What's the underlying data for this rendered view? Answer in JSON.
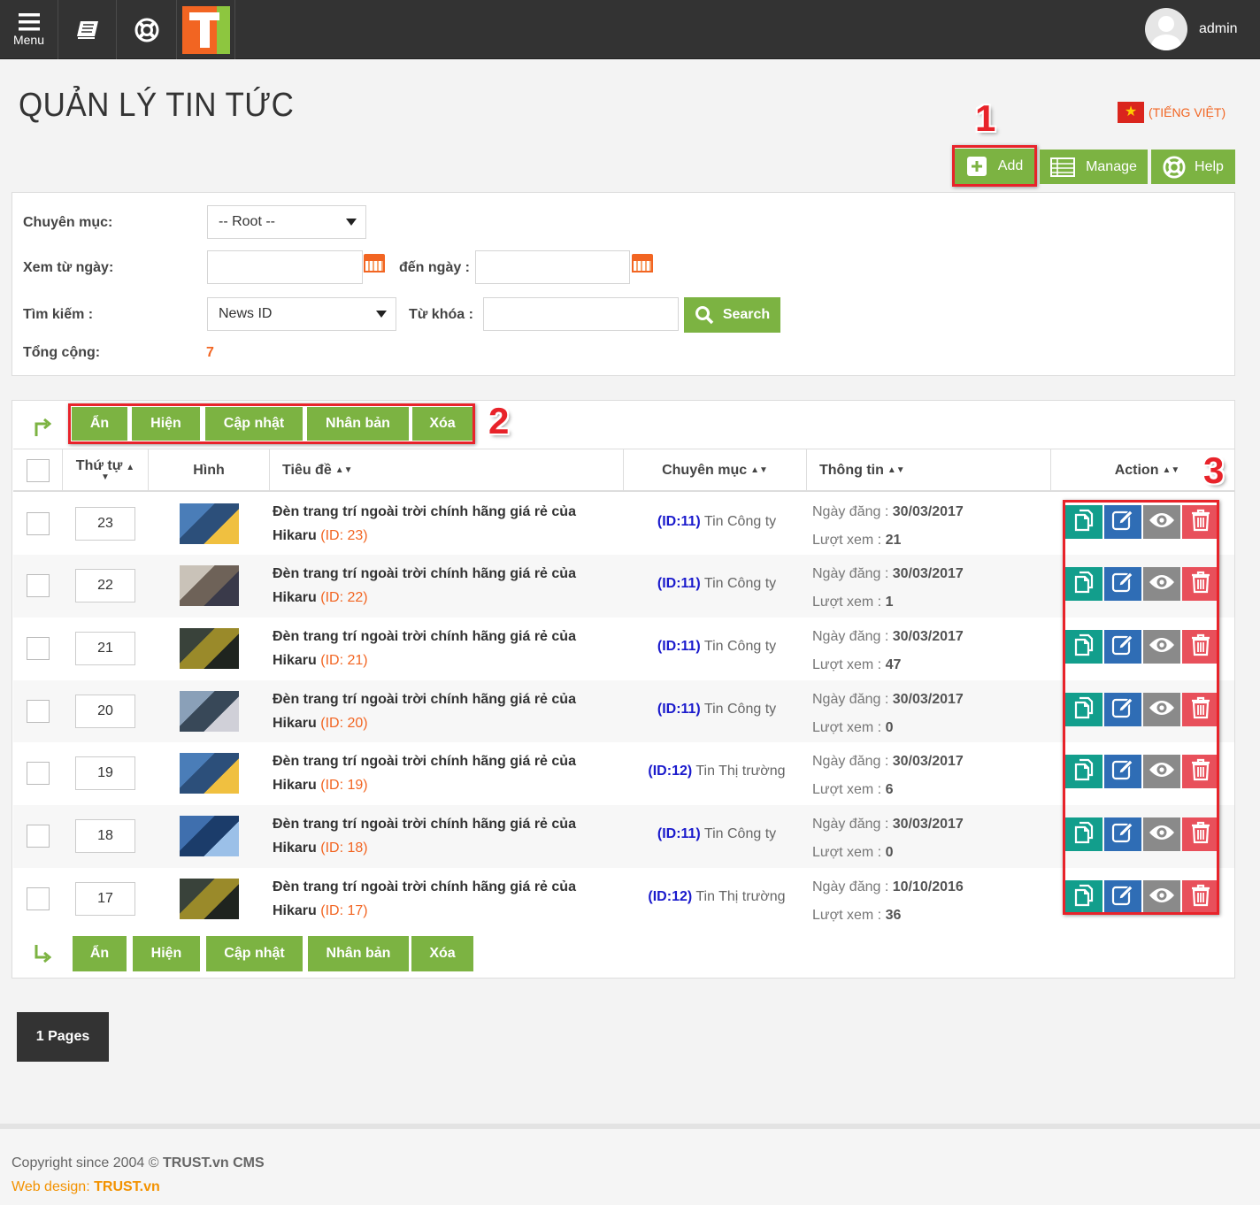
{
  "topbar": {
    "menu_label": "Menu",
    "username": "admin"
  },
  "page": {
    "title": "QUẢN LÝ TIN TỨC",
    "language": "(TIẾNG VIỆT)"
  },
  "annotations": [
    "1",
    "2",
    "3"
  ],
  "toolbar": {
    "add": "Add",
    "manage": "Manage",
    "help": "Help"
  },
  "filter": {
    "category_label": "Chuyên mục:",
    "category_value": "-- Root --",
    "from_label": "Xem từ ngày:",
    "from_value": "",
    "to_label": "đến ngày :",
    "to_value": "",
    "search_label": "Tìm kiếm :",
    "search_field": "News ID",
    "keyword_label": "Từ khóa :",
    "keyword_value": "",
    "search_button": "Search",
    "total_label": "Tổng cộng:",
    "total_value": "7"
  },
  "bulk_actions": {
    "hide": "Ẩn",
    "show": "Hiện",
    "update": "Cập nhật",
    "duplicate": "Nhân bản",
    "delete": "Xóa"
  },
  "table": {
    "headers": {
      "order": "Thứ tự",
      "image": "Hình",
      "title": "Tiêu đề",
      "category": "Chuyên mục",
      "info": "Thông tin",
      "action": "Action"
    },
    "date_label": "Ngày đăng :",
    "views_label": "Lượt xem :",
    "rows": [
      {
        "order": "23",
        "title": "Đèn trang trí ngoài trời chính hãng giá rẻ của Hikaru",
        "id_text": "(ID: 23)",
        "cat_id": "(ID:11)",
        "cat_name": "Tin Công ty",
        "date": "30/03/2017",
        "views": "21"
      },
      {
        "order": "22",
        "title": "Đèn trang trí ngoài trời chính hãng giá rẻ của Hikaru",
        "id_text": "(ID: 22)",
        "cat_id": "(ID:11)",
        "cat_name": "Tin Công ty",
        "date": "30/03/2017",
        "views": "1"
      },
      {
        "order": "21",
        "title": "Đèn trang trí ngoài trời chính hãng giá rẻ của Hikaru",
        "id_text": "(ID: 21)",
        "cat_id": "(ID:11)",
        "cat_name": "Tin Công ty",
        "date": "30/03/2017",
        "views": "47"
      },
      {
        "order": "20",
        "title": "Đèn trang trí ngoài trời chính hãng giá rẻ của Hikaru",
        "id_text": "(ID: 20)",
        "cat_id": "(ID:11)",
        "cat_name": "Tin Công ty",
        "date": "30/03/2017",
        "views": "0"
      },
      {
        "order": "19",
        "title": "Đèn trang trí ngoài trời chính hãng giá rẻ của Hikaru",
        "id_text": "(ID: 19)",
        "cat_id": "(ID:12)",
        "cat_name": "Tin Thị trường",
        "date": "30/03/2017",
        "views": "6"
      },
      {
        "order": "18",
        "title": "Đèn trang trí ngoài trời chính hãng giá rẻ của Hikaru",
        "id_text": "(ID: 18)",
        "cat_id": "(ID:11)",
        "cat_name": "Tin Công ty",
        "date": "30/03/2017",
        "views": "0"
      },
      {
        "order": "17",
        "title": "Đèn trang trí ngoài trời chính hãng giá rẻ của Hikaru",
        "id_text": "(ID: 17)",
        "cat_id": "(ID:12)",
        "cat_name": "Tin Thị trường",
        "date": "10/10/2016",
        "views": "36"
      }
    ]
  },
  "pagination": {
    "label": "1 Pages"
  },
  "footer": {
    "copyright_prefix": "Copyright since 2004 ©",
    "copyright_brand": "TRUST.vn CMS",
    "webdesign_prefix": "Web design:",
    "webdesign_brand": "TRUST.vn"
  },
  "colors": {
    "green_button": "#7cb342",
    "copy_action": "#129e8c",
    "edit_action": "#2f6db5",
    "view_action": "#8a8a8a",
    "delete_action": "#e8505b",
    "accent_orange": "#f26522"
  },
  "icons": [
    "menu-icon",
    "book-icon",
    "lifebuoy-icon",
    "plus-icon",
    "list-icon",
    "search-icon",
    "calendar-icon",
    "copy-icon",
    "edit-icon",
    "eye-icon",
    "trash-icon"
  ]
}
